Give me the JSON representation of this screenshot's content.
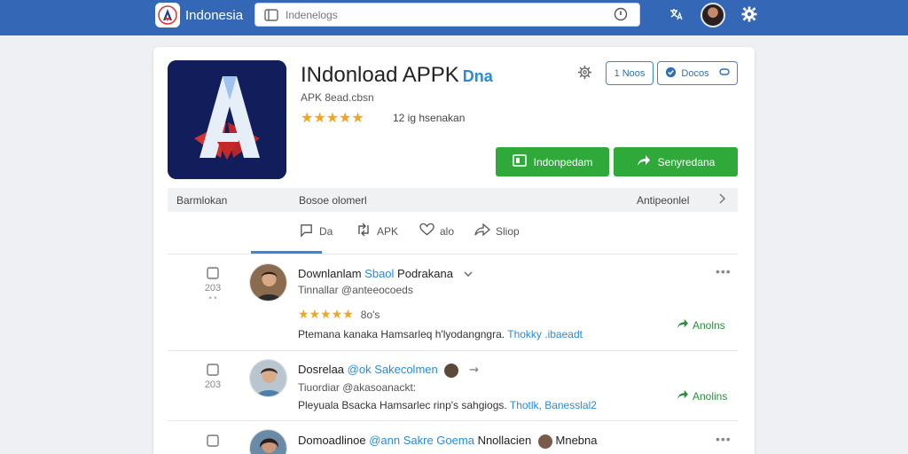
{
  "header": {
    "brand": "Indonesia",
    "search_placeholder": "Indenelogs"
  },
  "app": {
    "title": "INdonload APPK",
    "tag": "Dna",
    "subtitle": "APK 8ead.cbsn",
    "stars": "★★★★★",
    "rating_text": "12 ig hsenakan",
    "btn_follow": "1 Noos",
    "btn_secondary": "Docos",
    "btn_download": "Indonpedam",
    "btn_share": "Senyredana"
  },
  "infobar": {
    "left": "Barmlokan",
    "middle": "Bosoe olomerl",
    "right": "Antipeonlel"
  },
  "actions": [
    {
      "label": "Da"
    },
    {
      "label": "APK"
    },
    {
      "label": "alo"
    },
    {
      "label": "Sliop"
    }
  ],
  "comments": [
    {
      "side_count": "203",
      "name": "Downlanlam",
      "mention": "Sbaol",
      "name_rest": "Podrakana",
      "handle": "Tinnallar @anteeocoeds",
      "stars": "★★★★★",
      "stars_label": "8o's",
      "text": "Ptemana kanaka Hamsarleq h'lyodangngra.",
      "link": "Thokky .ibaeadt",
      "share": "Anolns"
    },
    {
      "side_count": "203",
      "name": "Dosrelaa",
      "mention": "@ok Sakecolmen",
      "name_rest": "",
      "handle": "Tiuordiar @akasoanackt:",
      "text": "Pleyuala Bsacka Hamsarlec rinp's sahgiogs.",
      "link": "Thotlk, Banesslal2",
      "share": "Anolins"
    },
    {
      "side_count": "",
      "name": "Domoadlinoe",
      "mention": "@ann Sakre Goema",
      "name_rest": "Nnollacien",
      "name_tail": "Mnebna",
      "handle": "...",
      "text": "",
      "link": "",
      "share": ""
    }
  ],
  "colors": {
    "header_bg": "#3567b7",
    "accent": "#2a8ad8",
    "green": "#2faa3a",
    "star": "#f0a623"
  }
}
